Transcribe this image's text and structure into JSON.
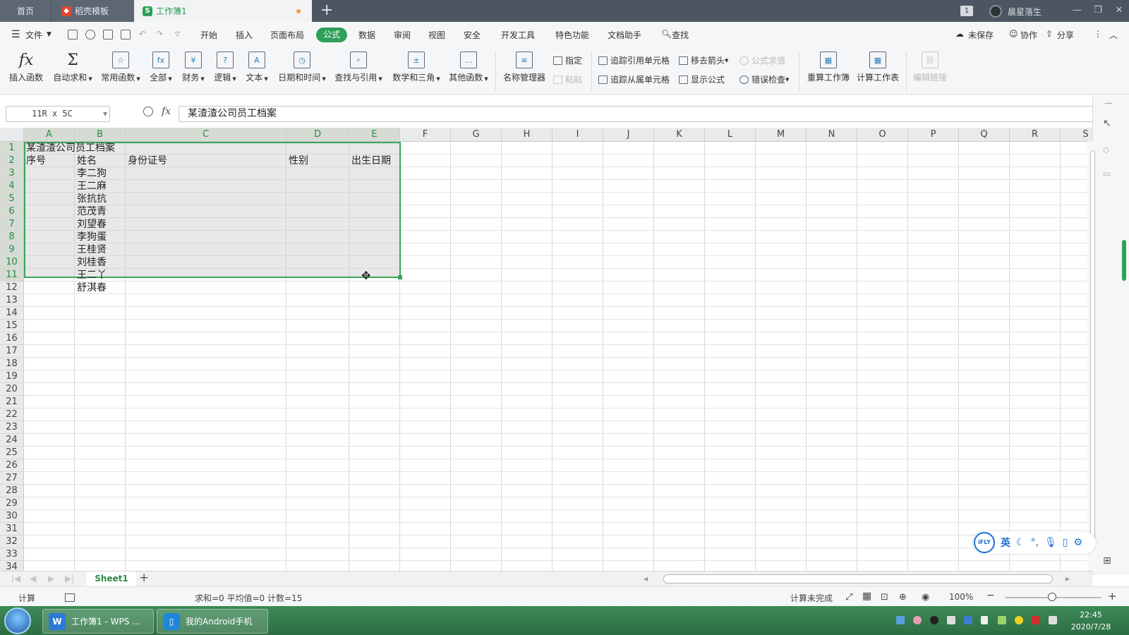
{
  "titlebar": {
    "tabs": [
      {
        "label": "首页"
      },
      {
        "label": "稻壳模板"
      },
      {
        "label": "工作簿1"
      }
    ],
    "window_badge": "1",
    "user_name": "晨星落生"
  },
  "menubar": {
    "file_label": "文件",
    "items": [
      "开始",
      "插入",
      "页面布局",
      "公式",
      "数据",
      "审阅",
      "视图",
      "安全",
      "开发工具",
      "特色功能",
      "文档助手"
    ],
    "search_label": "查找",
    "unsaved_label": "未保存",
    "collab_label": "协作",
    "share_label": "分享"
  },
  "ribbon": {
    "insert_function": "插入函数",
    "autosum": "自动求和",
    "common_functions": "常用函数",
    "all": "全部",
    "finance": "财务",
    "logic": "逻辑",
    "text": "文本",
    "datetime": "日期和时间",
    "lookup": "查找与引用",
    "math": "数学和三角",
    "other": "其他函数",
    "name_manager": "名称管理器",
    "assign": "指定",
    "paste": "粘贴",
    "trace_precedents": "追踪引用单元格",
    "trace_dependents": "追踪从属单元格",
    "remove_arrows": "移去箭头",
    "show_formulas": "显示公式",
    "evaluate": "公式求值",
    "error_check": "错误检查",
    "recalc_workbook": "重算工作簿",
    "calc_sheet": "计算工作表",
    "edit_links": "编辑链接"
  },
  "formula_bar": {
    "name_box": "11R x 5C",
    "fx": "fx",
    "content": "某渣渣公司员工档案"
  },
  "grid": {
    "columns": [
      "A",
      "B",
      "C",
      "D",
      "E",
      "F",
      "G",
      "H",
      "I",
      "J",
      "K",
      "L",
      "M",
      "N",
      "O",
      "P",
      "Q",
      "R",
      "S"
    ],
    "rows": [
      "1",
      "2",
      "3",
      "4",
      "5",
      "6",
      "7",
      "8",
      "9",
      "10",
      "11",
      "12",
      "13",
      "14",
      "15",
      "16",
      "17",
      "18",
      "19",
      "20",
      "21",
      "22",
      "23",
      "24",
      "25",
      "26",
      "27",
      "28",
      "29",
      "30",
      "31",
      "32",
      "33",
      "34"
    ],
    "cells": {
      "A1": "某渣渣公司员工档案",
      "A2": "序号",
      "B2": "姓名",
      "C2": "身份证号",
      "D2": "性别",
      "E2": "出生日期",
      "B3": "李二狗",
      "B4": "王二麻",
      "B5": "张抗抗",
      "B6": "范茂青",
      "B7": "刘望春",
      "B8": "李狗蛋",
      "B9": "王桂贤",
      "B10": "刘桂香",
      "B11": "王二丫",
      "B12": "舒淇春"
    },
    "selection": "A1:E11"
  },
  "ime": {
    "logo": "iFLY",
    "lang": "英"
  },
  "sheets": {
    "active": "Sheet1",
    "add": "+"
  },
  "statusbar": {
    "mode": "计算",
    "stats": "求和=0  平均值=0  计数=15",
    "calc_status": "计算未完成",
    "zoom": "100%"
  },
  "taskbar": {
    "items": [
      {
        "label": "工作簿1 - WPS ..."
      },
      {
        "label": "我的Android手机"
      }
    ],
    "time": "22:45",
    "date": "2020/7/28"
  },
  "colors": {
    "accent_green": "#2fa05a",
    "titlebar": "#4c5561",
    "taskbar": "#2d6e43"
  }
}
